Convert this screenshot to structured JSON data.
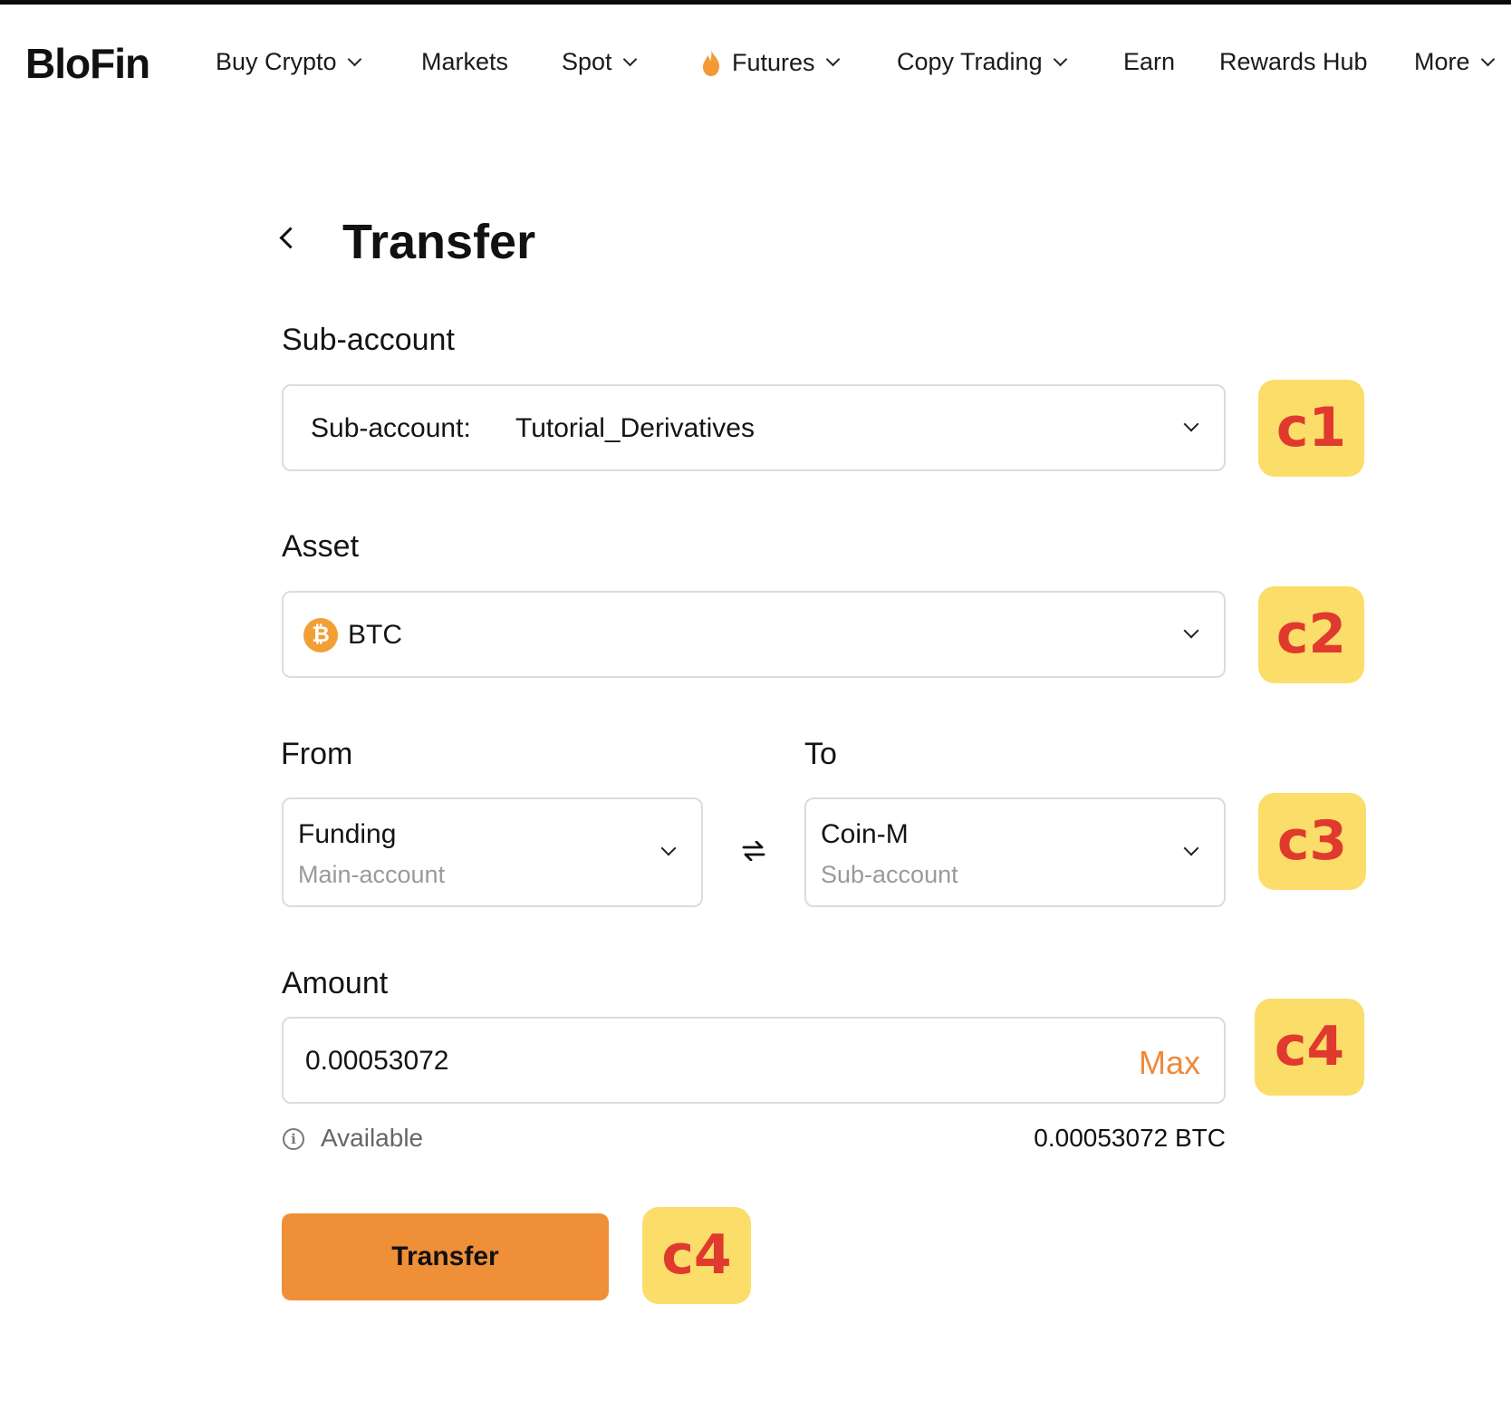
{
  "nav": {
    "logo": "BloFin",
    "items": [
      {
        "label": "Buy Crypto",
        "dropdown": true
      },
      {
        "label": "Markets",
        "dropdown": false
      },
      {
        "label": "Spot",
        "dropdown": true
      },
      {
        "label": "Futures",
        "dropdown": true,
        "icon": "flame-icon"
      },
      {
        "label": "Copy Trading",
        "dropdown": true
      },
      {
        "label": "Earn",
        "dropdown": false
      },
      {
        "label": "Rewards Hub",
        "dropdown": false
      },
      {
        "label": "More",
        "dropdown": true
      }
    ]
  },
  "page": {
    "title": "Transfer"
  },
  "subaccount": {
    "label": "Sub-account",
    "prefix": "Sub-account:",
    "value": "Tutorial_Derivatives"
  },
  "asset": {
    "label": "Asset",
    "value": "BTC",
    "icon_glyph": "₿"
  },
  "from": {
    "label": "From",
    "account": "Funding",
    "type": "Main-account"
  },
  "to": {
    "label": "To",
    "account": "Coin-M",
    "type": "Sub-account"
  },
  "amount": {
    "label": "Amount",
    "value": "0.00053072",
    "max_label": "Max"
  },
  "available": {
    "label": "Available",
    "value": "0.00053072 BTC"
  },
  "transfer_button": "Transfer",
  "badges": [
    "c1",
    "c2",
    "c3",
    "c4",
    "c4"
  ],
  "colors": {
    "accent": "#f0893a",
    "button": "#ef8f38",
    "badge_bg": "#fbdd6a",
    "badge_text": "#e03a2e"
  }
}
